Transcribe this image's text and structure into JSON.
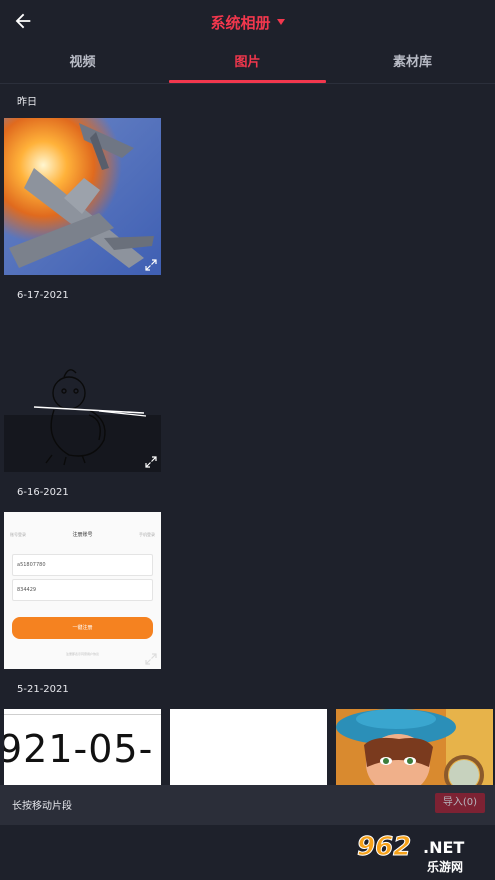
{
  "header": {
    "title": "系统相册",
    "back_icon": "arrow-left-icon",
    "dropdown_icon": "caret-down-icon",
    "accent_color": "#f2374d"
  },
  "tabs": [
    {
      "label": "视频",
      "active": false
    },
    {
      "label": "图片",
      "active": true
    },
    {
      "label": "素材库",
      "active": false
    }
  ],
  "groups": [
    {
      "label": "昨日",
      "items": [
        {
          "name": "fighter-jet-image"
        }
      ]
    },
    {
      "label": "6-17-2021",
      "items": [
        {
          "name": "sketch-character-image"
        }
      ]
    },
    {
      "label": "6-16-2021",
      "items": [
        {
          "name": "register-screenshot-image"
        }
      ]
    },
    {
      "label": "5-21-2021",
      "items": [
        {
          "name": "date-text-image"
        },
        {
          "name": "blank-white-image"
        },
        {
          "name": "game-character-image"
        }
      ]
    }
  ],
  "register_screenshot": {
    "left_tab": "账号登录",
    "title": "注册账号",
    "right_tab": "手机登录",
    "account": "a51807780",
    "password": "834429",
    "button": "一键注册",
    "footer": "注册即表示同意用户协议"
  },
  "date_image_text": "921-05-",
  "bottom_bar": {
    "hint": "长按移动片段",
    "import_label": "导入(0)"
  },
  "watermark": {
    "number": "962",
    "suffix": ".NET",
    "subtitle": "乐游网"
  }
}
